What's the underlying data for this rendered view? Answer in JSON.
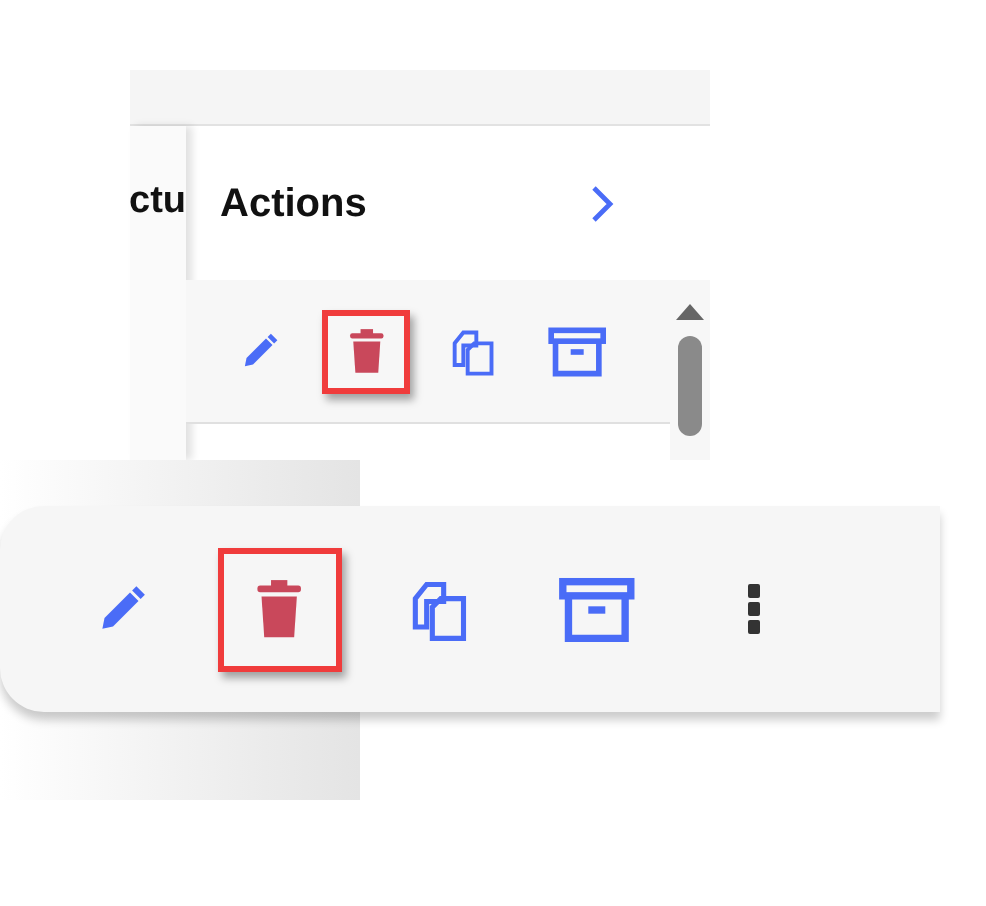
{
  "table": {
    "columns": [
      {
        "label": "ctu"
      },
      {
        "label": "Actions"
      }
    ],
    "row_actions": [
      {
        "kind": "edit",
        "selected": false
      },
      {
        "kind": "delete",
        "selected": true
      },
      {
        "kind": "copy",
        "selected": false
      },
      {
        "kind": "archive",
        "selected": false
      }
    ]
  },
  "toolbar": {
    "actions": [
      {
        "kind": "edit",
        "selected": false
      },
      {
        "kind": "delete",
        "selected": true
      },
      {
        "kind": "copy",
        "selected": false
      },
      {
        "kind": "archive",
        "selected": false
      },
      {
        "kind": "more",
        "selected": false
      }
    ]
  }
}
